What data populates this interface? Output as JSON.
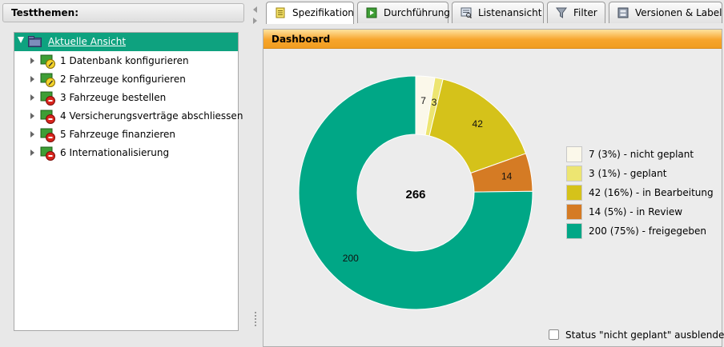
{
  "left_panel": {
    "title": "Testthemen:",
    "root": {
      "label": "Aktuelle Ansicht",
      "icon": "folder-icon"
    },
    "items": [
      {
        "label": "1 Datenbank konfigurieren",
        "icon": "pencil-status-icon"
      },
      {
        "label": "2 Fahrzeuge konfigurieren",
        "icon": "pencil-status-icon"
      },
      {
        "label": "3 Fahrzeuge bestellen",
        "icon": "stop-status-icon"
      },
      {
        "label": "4 Versicherungsverträge abschliessen",
        "icon": "stop-status-icon"
      },
      {
        "label": "5 Fahrzeuge finanzieren",
        "icon": "stop-status-icon"
      },
      {
        "label": "6 Internationalisierung",
        "icon": "stop-status-icon"
      }
    ]
  },
  "tabs": [
    {
      "label": "Spezifikation",
      "icon": "document-icon",
      "active": true
    },
    {
      "label": "Durchführung",
      "icon": "play-icon",
      "active": false
    },
    {
      "label": "Listenansicht",
      "icon": "list-view-icon",
      "active": false
    },
    {
      "label": "Filter",
      "icon": "funnel-icon",
      "active": false
    },
    {
      "label": "Versionen & Label",
      "icon": "versions-icon",
      "active": false
    }
  ],
  "dashboard": {
    "title": "Dashboard",
    "hide_option_label": "Status \"nicht geplant\" ausblenden",
    "hide_option_checked": false
  },
  "chart_data": {
    "type": "pie",
    "style": "donut",
    "total": 266,
    "total_label": "266",
    "series": [
      {
        "name": "nicht geplant",
        "value": 7,
        "label": "7",
        "legend": "7 (3%) - nicht geplant",
        "color": "#fbf8ea"
      },
      {
        "name": "geplant",
        "value": 3,
        "label": "3",
        "legend": "3 (1%) - geplant",
        "color": "#ede571"
      },
      {
        "name": "in Bearbeitung",
        "value": 42,
        "label": "42",
        "legend": "42 (16%) - in Bearbeitung",
        "color": "#d5c21a"
      },
      {
        "name": "in Review",
        "value": 14,
        "label": "14",
        "legend": "14 (5%) - in Review",
        "color": "#d57b24"
      },
      {
        "name": "freigegeben",
        "value": 200,
        "label": "200",
        "legend": "200 (75%) - freigegeben",
        "color": "#00a786"
      }
    ],
    "legend_position": "right"
  }
}
